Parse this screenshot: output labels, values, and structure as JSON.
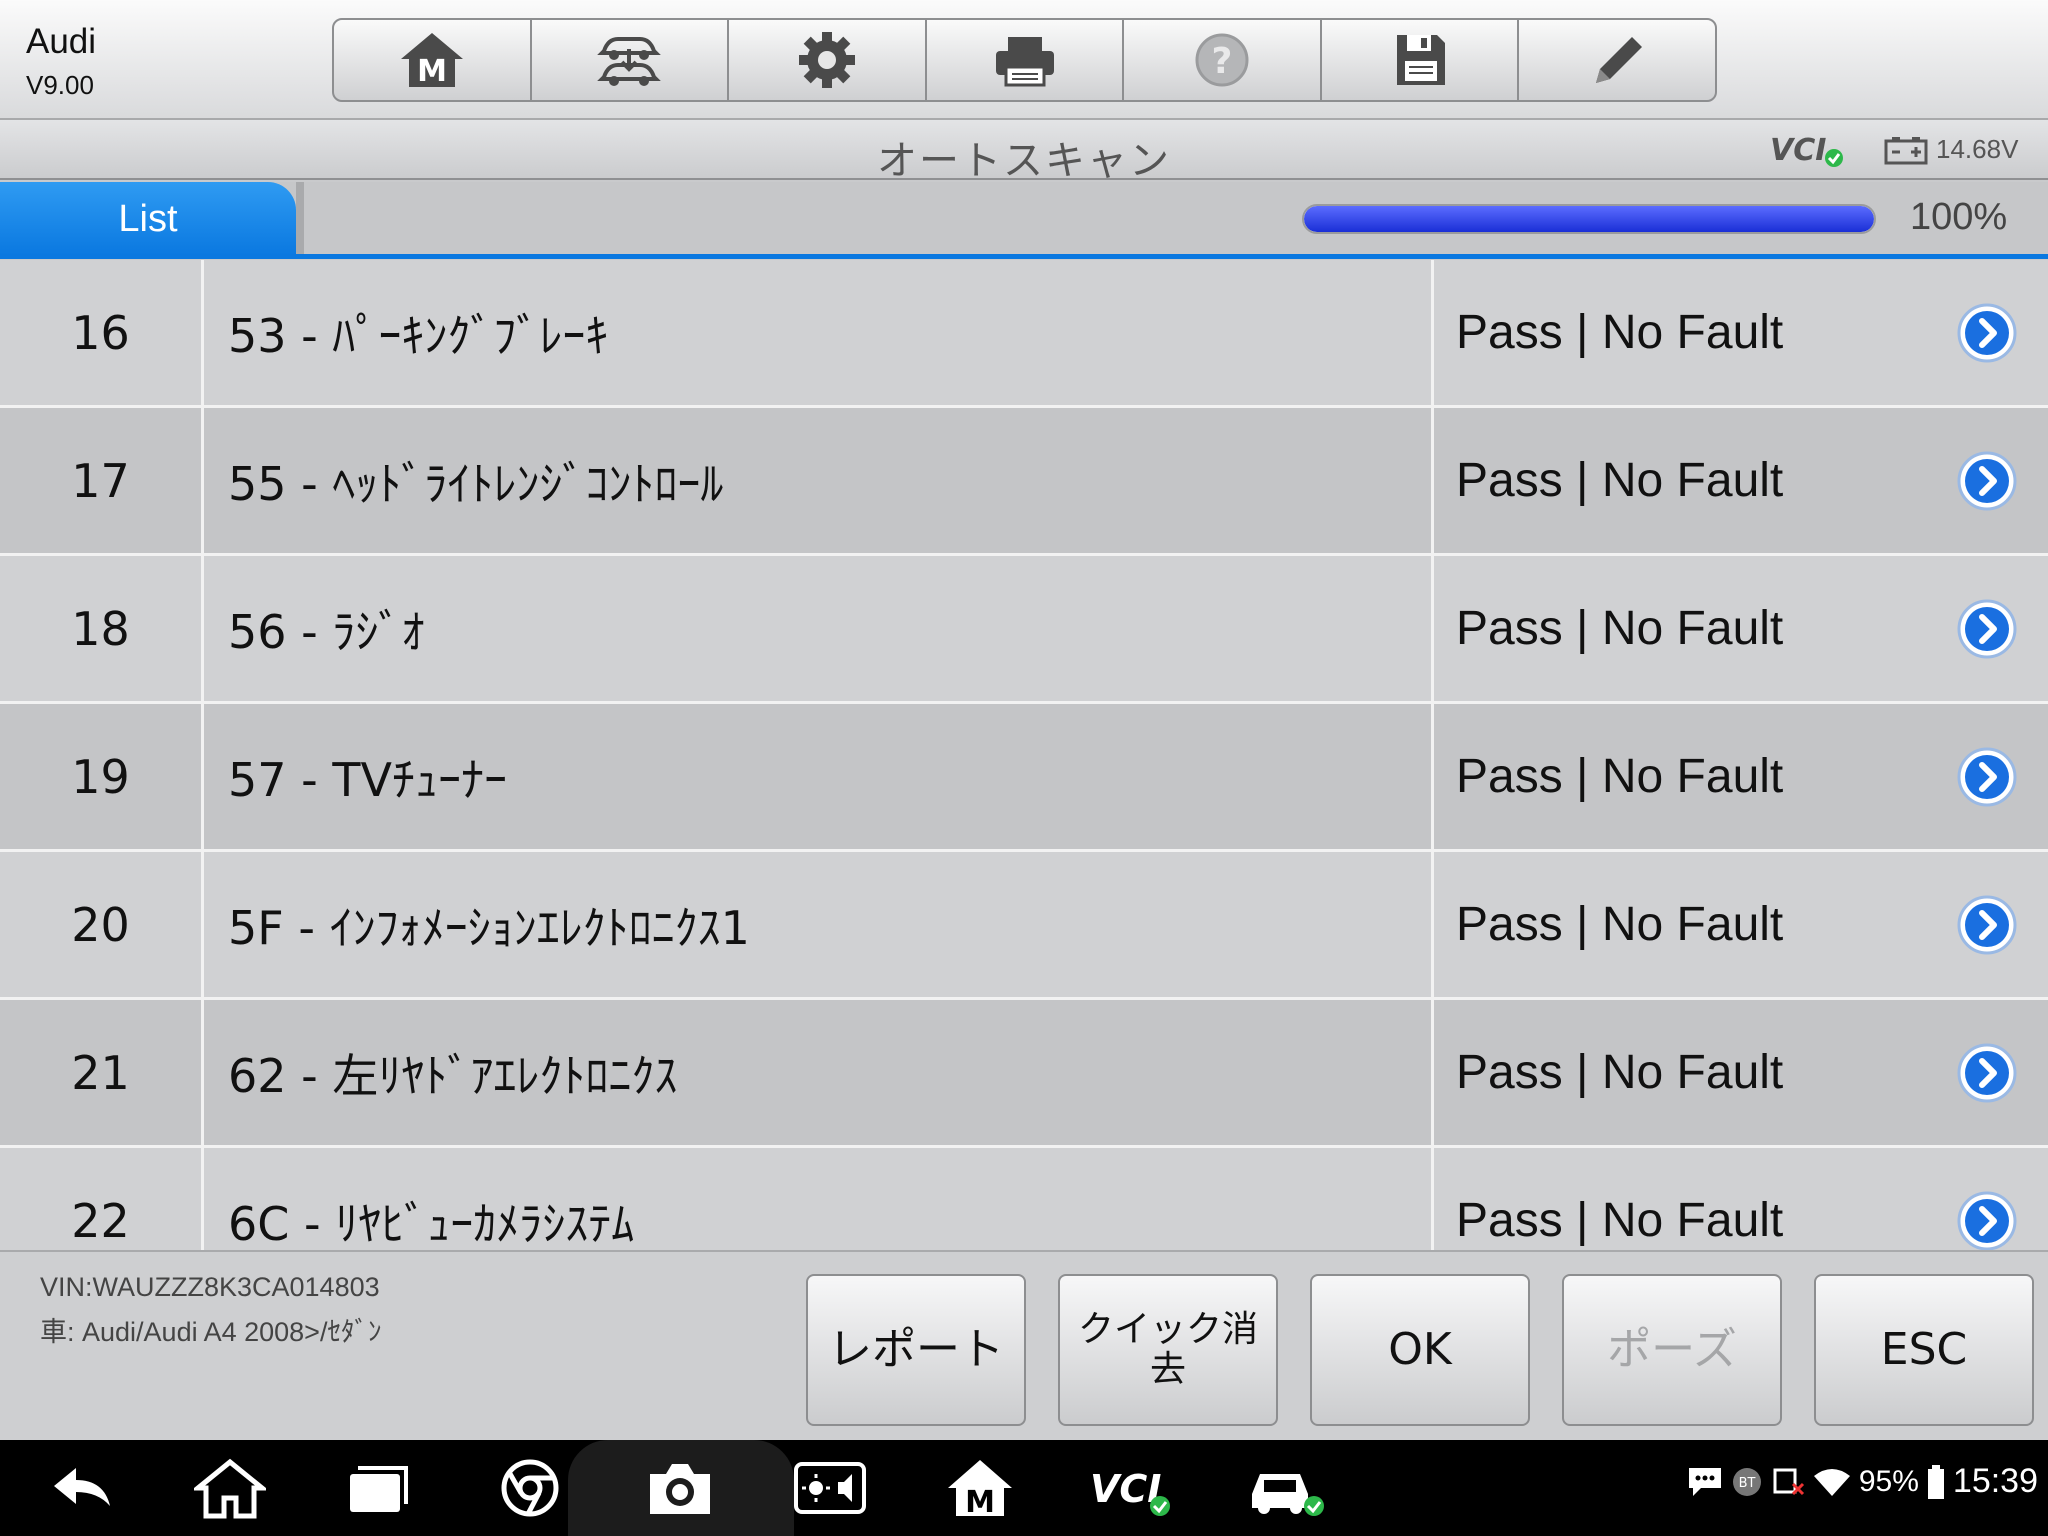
{
  "header": {
    "app_title": "Audi",
    "app_version": "V9.00",
    "toolbar_icons": [
      "home-m-icon",
      "vehicle-swap-icon",
      "settings-gear-icon",
      "printer-icon",
      "help-icon",
      "save-floppy-icon",
      "edit-pencil-icon"
    ]
  },
  "titlebar": {
    "title": "オートスキャン",
    "vci_label": "VCI",
    "voltage": "14.68V"
  },
  "tabs": {
    "active_tab": "List",
    "progress_percent": 100,
    "progress_text": "100%"
  },
  "rows": [
    {
      "num": "16",
      "name": "53 - ﾊﾟｰｷﾝｸﾞﾌﾞﾚｰｷ",
      "status": "Pass | No Fault"
    },
    {
      "num": "17",
      "name": "55 - ﾍｯﾄﾞﾗｲﾄﾚﾝｼﾞｺﾝﾄﾛｰﾙ",
      "status": "Pass | No Fault"
    },
    {
      "num": "18",
      "name": "56 - ﾗｼﾞｵ",
      "status": "Pass | No Fault"
    },
    {
      "num": "19",
      "name": "57 - TVﾁｭｰﾅｰ",
      "status": "Pass | No Fault"
    },
    {
      "num": "20",
      "name": "5F - ｲﾝﾌｫﾒｰｼｮﾝｴﾚｸﾄﾛﾆｸｽ1",
      "status": "Pass | No Fault"
    },
    {
      "num": "21",
      "name": "62 - 左ﾘﾔﾄﾞｱｴﾚｸﾄﾛﾆｸｽ",
      "status": "Pass | No Fault"
    },
    {
      "num": "22",
      "name": "6C - ﾘﾔﾋﾞｭｰｶﾒﾗｼｽﾃﾑ",
      "status": "Pass | No Fault"
    }
  ],
  "footer": {
    "vin": "VIN:WAUZZZ8K3CA014803",
    "car": "車: Audi/Audi A4 2008>/ｾﾀﾞﾝ",
    "buttons": {
      "report": "レポート",
      "quick_erase": "クイック消去",
      "ok": "OK",
      "pause": "ポーズ",
      "esc": "ESC"
    }
  },
  "system_bar": {
    "bt_label": "BT",
    "battery_percent": "95%",
    "time": "15:39"
  },
  "colors": {
    "accent_blue": "#0a78e0",
    "progress_blue": "#1a2fd6",
    "row_light": "#d0d1d3",
    "row_dark": "#c4c5c7"
  }
}
